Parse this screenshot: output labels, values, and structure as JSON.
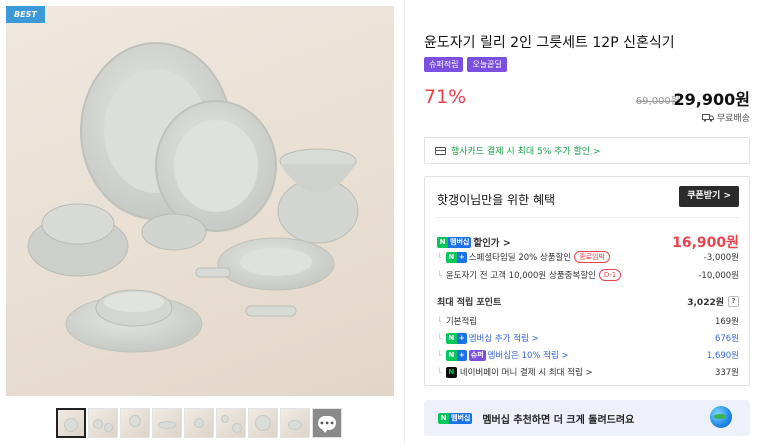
{
  "gallery": {
    "best_badge": "BEST",
    "thumb_count": 9
  },
  "product": {
    "title": "윤도자기 릴리 2인 그릇세트 12P 신혼식기",
    "badges": [
      "슈퍼적립",
      "오늘끝딜"
    ],
    "discount": "71%",
    "original_price": "69,000원",
    "sale_price": "29,900원",
    "shipping": "무료배송"
  },
  "card_promo": "행사카드 결제 시 최대 5% 추가 할인 >",
  "benefits": {
    "title": "핫갱이님만을 위한 혜택",
    "coupon_button": "쿠폰받기 >",
    "discount_label": "할인가 >",
    "discount_price": "16,900원",
    "discount_items": [
      {
        "label": "스페셜타임딜 20% 상품할인",
        "tag": "종료임박",
        "value": "-3,000원"
      },
      {
        "label": "윤도자기 전 고객 10,000원 상품중복할인",
        "tag": "D-1",
        "value": "-10,000원"
      }
    ],
    "points_label": "최대 적립 포인트",
    "points_total": "3,022원",
    "points_help": "?",
    "point_items": [
      {
        "label": "기본적립",
        "value": "169원"
      },
      {
        "label": "멤버십 추가 적립 >",
        "value": "676원"
      },
      {
        "label": "멤버십은 10% 적립 >",
        "value": "1,690원"
      },
      {
        "label": "네이버페이 머니 결제 시 최대 적립 >",
        "value": "337원"
      }
    ],
    "n_plus": "N",
    "membership_tag": "멤버십",
    "super_tag": "슈퍼"
  },
  "member_banner": "멤버십 추천하면 더 크게 돌려드려요",
  "colors": {
    "sale_red": "#e8424d",
    "naver_green": "#03c75a",
    "badge_purple": "#7b50e0"
  }
}
